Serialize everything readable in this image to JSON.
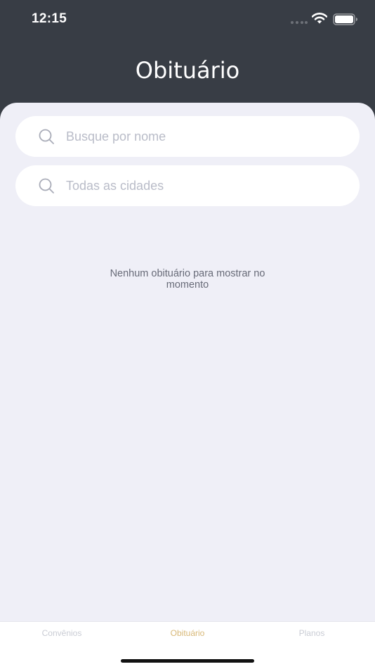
{
  "status_bar": {
    "time": "12:15"
  },
  "header": {
    "title": "Obituário"
  },
  "search": {
    "name_placeholder": "Busque por nome",
    "name_value": "",
    "city_placeholder": "Todas as cidades",
    "city_value": ""
  },
  "empty_state": {
    "message": "Nenhum obituário para mostrar no momento"
  },
  "tabs": [
    {
      "label": "Convênios",
      "active": false
    },
    {
      "label": "Obituário",
      "active": true
    },
    {
      "label": "Planos",
      "active": false
    }
  ],
  "colors": {
    "header_background": "#383d45",
    "content_background": "#efeff7",
    "active_tab": "#d8b877",
    "inactive_tab": "#c9ccd4"
  },
  "icons": {
    "search": "search-icon",
    "wifi": "wifi-icon",
    "battery": "battery-icon",
    "signal": "signal-icon"
  }
}
